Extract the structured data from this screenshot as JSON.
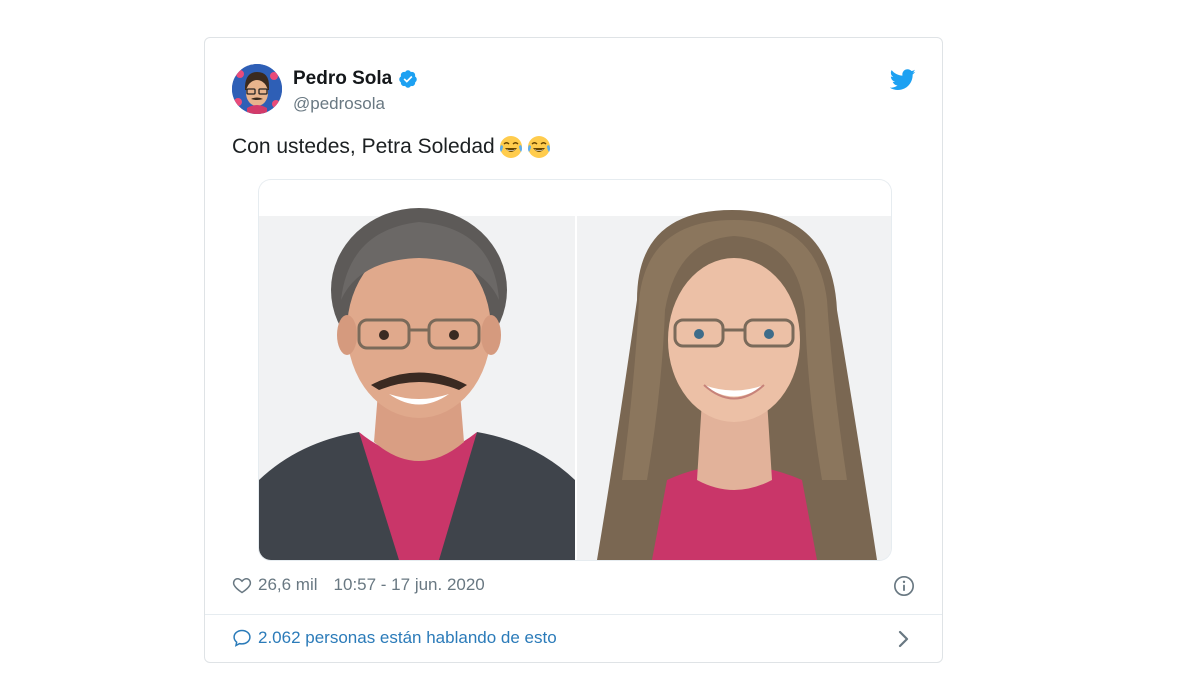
{
  "tweet": {
    "author": {
      "name": "Pedro Sola",
      "handle": "@pedrosola",
      "verified": true
    },
    "text": "Con ustedes, Petra Soledad",
    "emojis": [
      "face-with-tears-of-joy-icon",
      "face-with-tears-of-joy-icon"
    ],
    "media": {
      "images": [
        "man-portrait",
        "woman-portrait"
      ]
    },
    "likes": "26,6 mil",
    "timestamp": "10:57 - 17 jun. 2020",
    "conversation_link": "2.062 personas están hablando de esto"
  },
  "colors": {
    "accent": "#1da1f2",
    "link": "#2b7bb9",
    "muted": "#697882",
    "text": "#1c2022"
  }
}
